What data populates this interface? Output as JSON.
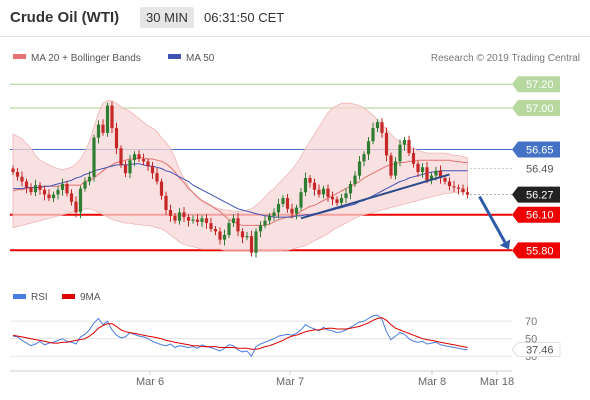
{
  "header": {
    "instrument": "Crude Oil (WTI)",
    "timeframe": "30 MIN",
    "time": "06:31:50 CET"
  },
  "colors": {
    "bull": "#2e7d32",
    "bear": "#c62828",
    "ma20": "#e57373",
    "ma50": "#3f51b5",
    "band_fill": "#f8d7d7",
    "resistance": "#a8d08d",
    "pivot": "#4472c4",
    "support": "#ee0000",
    "rsi": "#4a7de0",
    "rsi_ma": "#dd0000",
    "current": "#222222"
  },
  "chart_data": [
    {
      "type": "candlestick",
      "legend": [
        "MA 20 + Bollinger Bands",
        "MA 50"
      ],
      "credit": "Research © 2019 Trading Central",
      "x_labels": [
        "Mar 6",
        "Mar 7",
        "Mar 8",
        "Mar 18"
      ],
      "ylim": [
        55.55,
        57.32
      ],
      "levels": [
        {
          "value": 57.2,
          "label": "57.20",
          "kind": "resistance"
        },
        {
          "value": 57.0,
          "label": "57.00",
          "kind": "resistance"
        },
        {
          "value": 56.65,
          "label": "56.65",
          "kind": "pivot"
        },
        {
          "value": 56.49,
          "label": "56.49",
          "kind": "plain"
        },
        {
          "value": 56.27,
          "label": "56.27",
          "kind": "current"
        },
        {
          "value": 56.1,
          "label": "56.10",
          "kind": "support"
        },
        {
          "value": 55.8,
          "label": "55.80",
          "kind": "support"
        }
      ],
      "close": [
        56.46,
        56.42,
        56.38,
        56.33,
        56.29,
        56.35,
        56.31,
        56.27,
        56.24,
        56.27,
        56.31,
        56.36,
        56.28,
        56.21,
        56.12,
        56.32,
        56.38,
        56.42,
        56.75,
        56.86,
        56.79,
        57.02,
        56.83,
        56.66,
        56.52,
        56.45,
        56.56,
        56.61,
        56.57,
        56.55,
        56.51,
        56.45,
        56.38,
        56.26,
        56.14,
        56.09,
        56.05,
        56.12,
        56.08,
        56.05,
        56.06,
        56.04,
        56.07,
        56.03,
        55.98,
        55.96,
        55.89,
        55.93,
        56.03,
        56.07,
        55.96,
        55.91,
        55.92,
        55.78,
        55.96,
        56.01,
        56.05,
        56.09,
        56.12,
        56.19,
        56.24,
        56.15,
        56.11,
        56.16,
        56.29,
        56.41,
        56.37,
        56.31,
        56.27,
        56.32,
        56.25,
        56.23,
        56.2,
        56.24,
        56.28,
        56.36,
        56.43,
        56.55,
        56.61,
        56.72,
        56.83,
        56.88,
        56.79,
        56.6,
        56.43,
        56.55,
        56.69,
        56.73,
        56.62,
        56.53,
        56.46,
        56.5,
        56.39,
        56.43,
        56.47,
        56.41,
        56.38,
        56.34,
        56.33,
        56.32,
        56.29,
        56.27
      ],
      "ma20": [
        56.3,
        56.31,
        56.31,
        56.32,
        56.33,
        56.33,
        56.33,
        56.34,
        56.34,
        56.34,
        56.34,
        56.35,
        56.35,
        56.35,
        56.35,
        56.35,
        56.38,
        56.39,
        56.41,
        56.44,
        56.47,
        56.5,
        56.52,
        56.54,
        56.55,
        56.56,
        56.57,
        56.57,
        56.58,
        56.58,
        56.57,
        56.57,
        56.56,
        56.55,
        56.53,
        56.5,
        56.46,
        56.41,
        56.37,
        56.32,
        56.29,
        56.25,
        56.22,
        56.2,
        56.18,
        56.15,
        56.13,
        56.09,
        56.06,
        56.04,
        56.02,
        56.01,
        56.01,
        56.01,
        56.01,
        56.01,
        56.01,
        56.02,
        56.04,
        56.06,
        56.07,
        56.08,
        56.09,
        56.1,
        56.13,
        56.15,
        56.17,
        56.18,
        56.2,
        56.22,
        56.24,
        56.26,
        56.28,
        56.3,
        56.32,
        56.34,
        56.36,
        56.38,
        56.41,
        56.43,
        56.45,
        56.47,
        56.49,
        56.51,
        56.52,
        56.53,
        56.54,
        56.54,
        56.55,
        56.55,
        56.56,
        56.56,
        56.56,
        56.56,
        56.56,
        56.56,
        56.56,
        56.56,
        56.55,
        56.55,
        56.54,
        56.54
      ],
      "ma50": [
        56.32,
        56.32,
        56.32,
        56.33,
        56.33,
        56.33,
        56.33,
        56.34,
        56.34,
        56.35,
        56.36,
        56.37,
        56.38,
        56.39,
        56.41,
        56.42,
        56.44,
        56.45,
        56.47,
        56.48,
        56.49,
        56.5,
        56.51,
        56.52,
        56.52,
        56.52,
        56.52,
        56.53,
        56.53,
        56.52,
        56.51,
        56.51,
        56.5,
        56.49,
        56.47,
        56.46,
        56.44,
        56.42,
        56.4,
        56.38,
        56.35,
        56.33,
        56.31,
        56.29,
        56.27,
        56.25,
        56.23,
        56.21,
        56.19,
        56.17,
        56.15,
        56.14,
        56.13,
        56.12,
        56.11,
        56.1,
        56.09,
        56.09,
        56.08,
        56.08,
        56.08,
        56.08,
        56.08,
        56.09,
        56.09,
        56.1,
        56.1,
        56.11,
        56.11,
        56.12,
        56.13,
        56.14,
        56.15,
        56.16,
        56.17,
        56.18,
        56.19,
        56.21,
        56.22,
        56.24,
        56.26,
        56.28,
        56.3,
        56.32,
        56.34,
        56.36,
        56.38,
        56.39,
        56.41,
        56.42,
        56.43,
        56.44,
        56.45,
        56.46,
        56.46,
        56.47,
        56.47,
        56.47,
        56.47,
        56.47,
        56.47,
        56.47
      ],
      "bb_upper": [
        56.78,
        56.76,
        56.74,
        56.7,
        56.66,
        56.6,
        56.56,
        56.54,
        56.52,
        56.5,
        56.49,
        56.48,
        56.49,
        56.5,
        56.53,
        56.57,
        56.63,
        56.72,
        56.84,
        56.96,
        57.04,
        57.06,
        57.06,
        57.04,
        57.01,
        56.99,
        56.97,
        56.94,
        56.91,
        56.88,
        56.85,
        56.83,
        56.8,
        56.75,
        56.71,
        56.66,
        56.58,
        56.48,
        56.4,
        56.34,
        56.28,
        56.24,
        56.21,
        56.19,
        56.17,
        56.16,
        56.15,
        56.14,
        56.14,
        56.13,
        56.13,
        56.13,
        56.14,
        56.15,
        56.18,
        56.21,
        56.25,
        56.29,
        56.32,
        56.36,
        56.4,
        56.44,
        56.48,
        56.53,
        56.59,
        56.66,
        56.72,
        56.78,
        56.84,
        56.9,
        56.96,
        57.0,
        57.02,
        57.04,
        57.04,
        57.04,
        57.03,
        57.02,
        57.0,
        56.97,
        56.94,
        56.9,
        56.86,
        56.82,
        56.78,
        56.74,
        56.72,
        56.7,
        56.68,
        56.66,
        56.64,
        56.63,
        56.62,
        56.62,
        56.62,
        56.62,
        56.62,
        56.61,
        56.6,
        56.6,
        56.59,
        56.58
      ],
      "bb_lower": [
        55.99,
        56.0,
        56.01,
        56.02,
        56.03,
        56.04,
        56.05,
        56.06,
        56.07,
        56.08,
        56.09,
        56.1,
        56.11,
        56.12,
        56.13,
        56.14,
        56.15,
        56.15,
        56.14,
        56.12,
        56.1,
        56.08,
        56.06,
        56.05,
        56.04,
        56.03,
        56.03,
        56.02,
        56.02,
        56.01,
        56.01,
        56.0,
        55.99,
        55.98,
        55.96,
        55.93,
        55.9,
        55.87,
        55.85,
        55.84,
        55.83,
        55.82,
        55.81,
        55.81,
        55.81,
        55.81,
        55.81,
        55.8,
        55.8,
        55.8,
        55.8,
        55.8,
        55.8,
        55.8,
        55.79,
        55.79,
        55.79,
        55.79,
        55.79,
        55.79,
        55.8,
        55.8,
        55.81,
        55.82,
        55.83,
        55.84,
        55.86,
        55.88,
        55.9,
        55.92,
        55.94,
        55.97,
        55.99,
        56.01,
        56.03,
        56.05,
        56.07,
        56.09,
        56.1,
        56.11,
        56.12,
        56.13,
        56.14,
        56.15,
        56.16,
        56.17,
        56.18,
        56.19,
        56.2,
        56.21,
        56.22,
        56.23,
        56.24,
        56.25,
        56.26,
        56.27,
        56.28,
        56.28,
        56.29,
        56.29,
        56.3,
        56.3
      ],
      "forecast_target": 55.8,
      "trendline": [
        {
          "bar": 64,
          "value": 56.07
        },
        {
          "bar": 97,
          "value": 56.44
        }
      ]
    },
    {
      "type": "line",
      "legend": [
        "RSI",
        "9MA"
      ],
      "ylim": [
        20,
        85
      ],
      "levels": [
        70,
        50,
        30
      ],
      "current_label": "37.46",
      "rsi": [
        53,
        52,
        48,
        45,
        42,
        44,
        47,
        43,
        45,
        46,
        48,
        50,
        47,
        46,
        44,
        52,
        55,
        60,
        68,
        73,
        66,
        70,
        60,
        54,
        51,
        52,
        57,
        55,
        53,
        52,
        50,
        47,
        45,
        43,
        42,
        44,
        40,
        42,
        41,
        40,
        41,
        39,
        43,
        41,
        40,
        38,
        36,
        39,
        43,
        42,
        37,
        35,
        36,
        30,
        41,
        44,
        46,
        48,
        50,
        53,
        54,
        55,
        54,
        56,
        60,
        66,
        63,
        61,
        59,
        63,
        60,
        59,
        57,
        58,
        60,
        63,
        66,
        69,
        70,
        73,
        76,
        77,
        72,
        58,
        49,
        53,
        57,
        55,
        50,
        47,
        46,
        47,
        44,
        45,
        46,
        43,
        42,
        41,
        40,
        39,
        38,
        37.46
      ],
      "ma9": [
        54,
        53,
        52,
        51,
        50,
        49,
        48,
        47,
        46,
        45,
        45,
        46,
        46,
        47,
        48,
        49,
        50,
        53,
        57,
        62,
        65,
        67,
        67,
        64,
        60,
        58,
        57,
        56,
        55,
        54,
        53,
        52,
        51,
        50,
        48,
        47,
        46,
        45,
        44,
        43,
        42,
        42,
        41,
        41,
        41,
        41,
        40,
        40,
        40,
        40,
        39,
        39,
        39,
        38,
        38,
        39,
        41,
        42,
        44,
        46,
        48,
        51,
        53,
        54,
        56,
        58,
        59,
        60,
        60,
        61,
        62,
        62,
        61,
        61,
        61,
        62,
        63,
        64,
        66,
        68,
        71,
        73,
        74,
        71,
        66,
        62,
        60,
        58,
        56,
        54,
        52,
        50,
        49,
        48,
        47,
        46,
        45,
        44,
        43,
        42,
        41,
        40
      ]
    }
  ]
}
